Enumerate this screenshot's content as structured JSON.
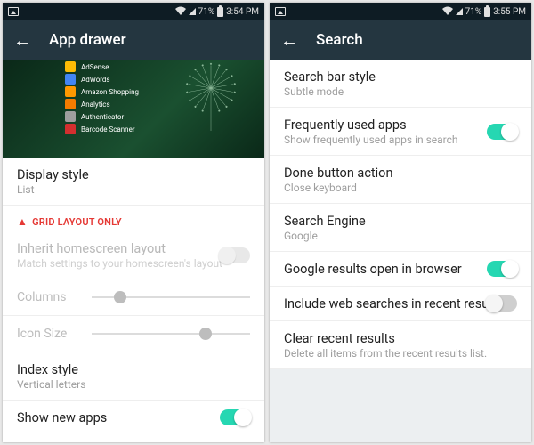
{
  "left": {
    "status": {
      "battery_pct": "71%",
      "time": "3:54 PM"
    },
    "header": {
      "title": "App drawer"
    },
    "preview_apps": [
      {
        "label": "AdSense",
        "color": "#fbbc05"
      },
      {
        "label": "AdWords",
        "color": "#4285f4"
      },
      {
        "label": "Amazon Shopping",
        "color": "#ff9900"
      },
      {
        "label": "Analytics",
        "color": "#f57c00"
      },
      {
        "label": "Authenticator",
        "color": "#9e9e9e"
      },
      {
        "label": "Barcode Scanner",
        "color": "#d32f2f"
      }
    ],
    "display_style": {
      "label": "Display style",
      "value": "List"
    },
    "grid_warning": "GRID LAYOUT ONLY",
    "inherit": {
      "label": "Inherit homescreen layout",
      "sub": "Match settings to your homescreen's layout"
    },
    "columns": {
      "label": "Columns",
      "pct": 18
    },
    "icon_size": {
      "label": "Icon Size",
      "pct": 72
    },
    "index_style": {
      "label": "Index style",
      "value": "Vertical letters"
    },
    "show_new": {
      "label": "Show new apps",
      "on": true
    }
  },
  "right": {
    "status": {
      "battery_pct": "71%",
      "time": "3:55 PM"
    },
    "header": {
      "title": "Search"
    },
    "rows": {
      "bar_style": {
        "label": "Search bar style",
        "sub": "Subtle mode"
      },
      "freq": {
        "label": "Frequently used apps",
        "sub": "Show frequently used apps in search",
        "on": true
      },
      "done": {
        "label": "Done button action",
        "sub": "Close keyboard"
      },
      "engine": {
        "label": "Search Engine",
        "sub": "Google"
      },
      "browser": {
        "label": "Google results open in browser",
        "on": true
      },
      "include_web": {
        "label": "Include web searches in recent results",
        "on": false
      },
      "clear": {
        "label": "Clear recent results",
        "sub": "Delete all items from the recent results list."
      }
    }
  }
}
